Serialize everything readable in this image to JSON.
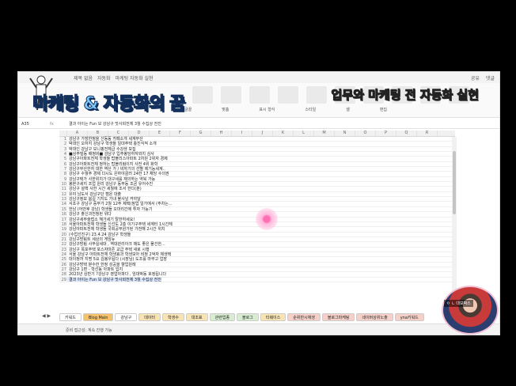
{
  "video": {
    "headline": "업무와 마케팅 전 자동화 실현",
    "logo_text": "마케팅 & 자동화의 꿈"
  },
  "window": {
    "title_items": [
      "제목 없음",
      "자동화",
      "마케팅 자동화 실현"
    ],
    "title_right": [
      "공유",
      "댓글"
    ]
  },
  "ribbon": {
    "group_labels": [
      "글꼴",
      "맞춤",
      "표시 형식",
      "스타일",
      "셀",
      "편집"
    ]
  },
  "formula_bar": {
    "name_box": "A35",
    "fx": "fx",
    "content": "결과 아이는 Fun 보 강남구 맛사회전체 3월 수집상 전진"
  },
  "grid": {
    "columns": [
      "",
      "A",
      "B",
      "C",
      "D",
      "E",
      "F",
      "G",
      "H",
      "I",
      "J",
      "K",
      "L",
      "M",
      "N",
      "O",
      "P",
      "Q",
      "R"
    ],
    "rows": [
      {
        "n": "1",
        "text": "강남구 가장한정을 신동동 카페소개 세계무산"
      },
      {
        "n": "2",
        "text": "박대인 오하지 강남구 학생들 일대주택 충진식적 소개"
      },
      {
        "n": "3",
        "text": "박대인 강남구 모니핑전체급 수강생 모집"
      },
      {
        "n": "4",
        "text": "■상주빌동 배정비■ 강남구 입주봉당하자와치 심사"
      },
      {
        "n": "5",
        "text": "강남구아파트전체 학생들 탑블리스아파트 2차원 2위자 경제"
      },
      {
        "n": "6",
        "text": "강남구아파트전체 정하는 탑블리림이지 사전 4위 화학"
      },
      {
        "n": "7",
        "text": "강남구부산한자 대한 역산 가 / 비자기의 선별 제기능세계.."
      },
      {
        "n": "8",
        "text": "강남구 수월주 경제 다시도 은하야골러 24한 17 채당 수의권"
      },
      {
        "n": "9",
        "text": "강남구택가 사한위치가 대구세를 재의하는 약북 가능"
      },
      {
        "n": "10",
        "text": "봉본구세지 조업 원리 강남구 동부동 조금 유어수진"
      },
      {
        "n": "11",
        "text": "강남구 설핵 사한 시간 세월에 조서 한다(분)"
      },
      {
        "n": "12",
        "text": "유야 남도서 강남구단 캠온 대출"
      },
      {
        "n": "13",
        "text": "강남구정보 봄길 기지도 가내 불사널 커야달"
      },
      {
        "n": "14",
        "text": "서초구 강남구 증부가 2월 12주 제택(정업 일가에서 (주차는..."
      },
      {
        "n": "15",
        "text": "한남 (어떤후 강남) 학생들 오마리간에 투자 가능기"
      },
      {
        "n": "16",
        "text": "강남구 출신과전정된 위다"
      },
      {
        "n": "17",
        "text": "강남구세부술접소 혜가세기 탈한하세요!"
      },
      {
        "n": "18",
        "text": "서울아파트전체 학생들 신선도 2층 이기구주택 세계터 1시간체"
      },
      {
        "n": "19",
        "text": "강남아파트전체 학생들 국회공무원가된 가전해 2시간 위치"
      },
      {
        "n": "20",
        "text": "(수업선진구) 23.4.24 강남구 학생들"
      },
      {
        "n": "21",
        "text": "강남구방림트 세상의 게임뉴"
      },
      {
        "n": "22",
        "text": "강남구방림 사무실세대 , 역대관리아크 매도 좋은 물건한..."
      },
      {
        "n": "23",
        "text": "강남구 목포주택 포스자마존 교급 주택 새로 시행"
      },
      {
        "n": "24",
        "text": "서울 강남구 아파트전체 학생효과 학생모아 비정 2억자 제생택"
      },
      {
        "n": "25",
        "text": "대이정까 지명 5요 김봉우됩다 (시장님) 도조를 마무고 업장"
      },
      {
        "n": "26",
        "text": "강남구방택 분수한 한정 성공을 향업원례"
      },
      {
        "n": "27",
        "text": "강남구 1편 - 학선동 아파트 입지"
      },
      {
        "n": "28",
        "text": "2023년 상반기 ?강남구 영업아파다 , 임대박동 호정됩니다"
      },
      {
        "n": "29",
        "text": "결과 아이는 Fun 보 강남구 맛사회전체 3월 수집상 전진"
      }
    ]
  },
  "sheet_tabs": [
    "키워드",
    "Blog Main",
    "강남구",
    "데이터",
    "학생수",
    "대조표",
    "관련업종",
    "블로그",
    "티웨이스",
    "순위반시재생",
    "블로그마케팅",
    "네이버상위노출",
    "yna키워드"
  ],
  "tab_colors": [
    "#ffffff",
    "#f4c26b",
    "#ffffff",
    "#f7e3b3",
    "#f7e3b3",
    "#f7e3b3",
    "#d7ecd0",
    "#d7ecd0",
    "#f7e3b3",
    "#f4d0c8",
    "#f4d0c8",
    "#f4d0c8",
    "#f4d0c8"
  ],
  "status_bar": {
    "text": "준비  접근성: 계속 진행 가능"
  },
  "webcam": {
    "label": "ㅇ ㄴ 대보박스"
  }
}
